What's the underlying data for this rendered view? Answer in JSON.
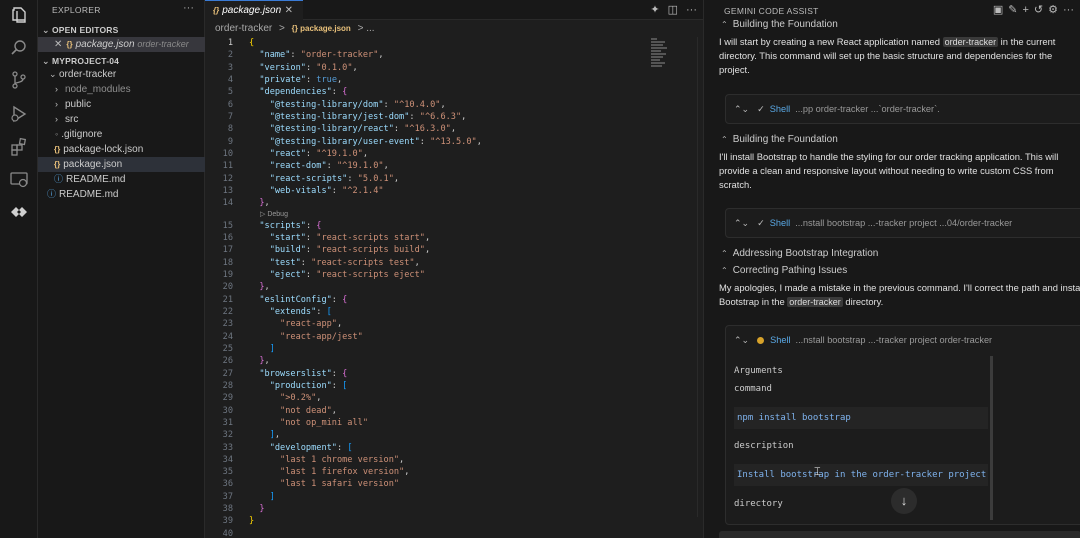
{
  "explorer": {
    "title": "EXPLORER",
    "more": "···",
    "open_editors_label": "OPEN EDITORS",
    "open_editor": {
      "name": "package.json",
      "path": "order-tracker"
    },
    "project_label": "MYPROJECT-04",
    "tree": {
      "folder": "order-tracker",
      "items": [
        {
          "label": "node_modules",
          "kind": "folder"
        },
        {
          "label": "public",
          "kind": "folder"
        },
        {
          "label": "src",
          "kind": "folder"
        },
        {
          "label": ".gitignore",
          "kind": "git"
        },
        {
          "label": "package-lock.json",
          "kind": "json"
        },
        {
          "label": "package.json",
          "kind": "json"
        },
        {
          "label": "README.md",
          "kind": "md"
        }
      ],
      "root_file": "README.md"
    }
  },
  "editor": {
    "tab": "package.json",
    "breadcrumb": [
      "order-tracker",
      ">",
      "{} package.json",
      "> ..."
    ],
    "codelens": "▷ Debug",
    "line_count": 40
  },
  "gemini": {
    "title": "GEMINI CODE ASSIST",
    "steps": {
      "s1": "Building the Foundation",
      "s2": "Building the Foundation",
      "s3": "Addressing Bootstrap Integration",
      "s4": "Correcting Pathing Issues"
    },
    "para1": {
      "pre": "I will start by creating a new React application named ",
      "chip": "order-tracker",
      "post": " in the current directory. This command will set up the basic structure and dependencies for the project."
    },
    "para2": "I'll install Bootstrap to handle the styling for our order tracking application. This will provide a clean and responsive layout without needing to write custom CSS from scratch.",
    "para3": {
      "pre": "My apologies, I made a mistake in the previous command. I'll correct the path and insta",
      "mid": "Bootstrap in the ",
      "chip": "order-tracker",
      "post": " directory."
    },
    "shell1": {
      "label": "Shell",
      "cmd": "...pp order-tracker ...`order-tracker`."
    },
    "shell2": {
      "label": "Shell",
      "cmd": "...nstall bootstrap ...-tracker project ...04/order-tracker"
    },
    "shell3": {
      "label": "Shell",
      "cmd": "...nstall bootstrap ...-tracker project order-tracker",
      "arguments_label": "Arguments",
      "command_label": "command",
      "command_value": "npm install bootstrap",
      "description_label": "description",
      "description_value": "Install bootstrap in the order-tracker project",
      "directory_label": "directory"
    },
    "scroll_down": "↓"
  }
}
